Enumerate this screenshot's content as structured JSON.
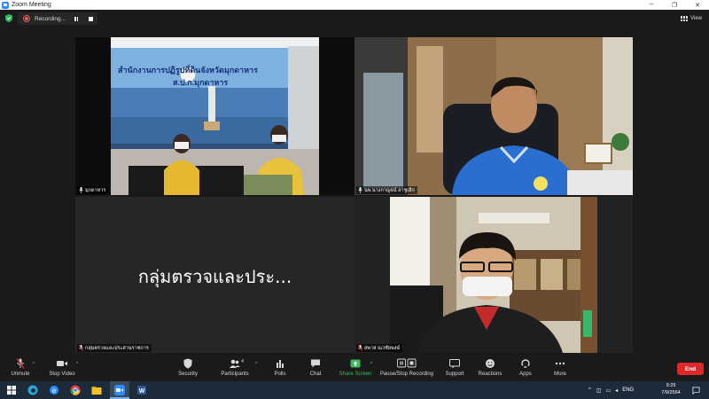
{
  "window": {
    "title": "Zoom Meeting",
    "controls": [
      "─",
      "❐",
      "✕"
    ]
  },
  "recording": {
    "label": "Recording..."
  },
  "view": {
    "label": "View"
  },
  "tiles": [
    {
      "name": "มุกดาหาร",
      "banner_line1": "สำนักงานการปฏิรูปที่ดินจังหวัดมุกดาหาร",
      "banner_line2": "ส.ป.ก.มุกดาหาร"
    },
    {
      "name": "นพ.นางกาญจน์ ลาชูเอีก"
    },
    {
      "name": "กลุ่มตรวจและประสานราชการ",
      "display_text": "กลุ่มตรวจและประ..."
    },
    {
      "name": "สพาส ณวชัยพงษ์"
    }
  ],
  "toolbar": {
    "unmute": "Unmute",
    "stop_video": "Stop Video",
    "security": "Security",
    "participants": "Participants",
    "participants_count": "4",
    "polls": "Polls",
    "chat": "Chat",
    "share_screen": "Share Screen",
    "pause_stop_recording": "Pause/Stop Recording",
    "support": "Support",
    "reactions": "Reactions",
    "apps": "Apps",
    "more": "More",
    "end": "End"
  },
  "taskbar": {
    "lang": "ENG",
    "time": "9:29",
    "date": "7/9/2564"
  },
  "colors": {
    "active_speaker": "#c6d63a",
    "share_green": "#3dbb5f",
    "end_red": "#e02828",
    "zoom_blue": "#2d8cff"
  }
}
